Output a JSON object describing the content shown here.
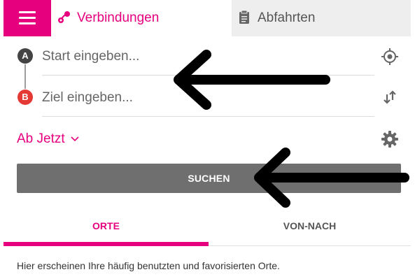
{
  "header": {
    "menu_icon": "hamburger-menu-icon",
    "tabs": [
      {
        "label": "Verbindungen",
        "icon": "route-icon",
        "active": true
      },
      {
        "label": "Abfahrten",
        "icon": "clipboard-icon",
        "active": false
      }
    ]
  },
  "form": {
    "start": {
      "badge": "A",
      "placeholder": "Start eingeben..."
    },
    "destination": {
      "badge": "B",
      "placeholder": "Ziel eingeben..."
    },
    "time_select": "Ab Jetzt",
    "search_button": "SUCHEN"
  },
  "lower_tabs": [
    {
      "label": "ORTE",
      "active": true
    },
    {
      "label": "VON-NACH",
      "active": false
    }
  ],
  "hint_text": "Hier erscheinen Ihre häufig benutzten und favorisierten Orte.",
  "colors": {
    "accent": "#e6007e",
    "search_button": "#6f6f6f",
    "inactive_tab": "#eeeeee",
    "badge_a": "#444444",
    "badge_b": "#e53935"
  }
}
